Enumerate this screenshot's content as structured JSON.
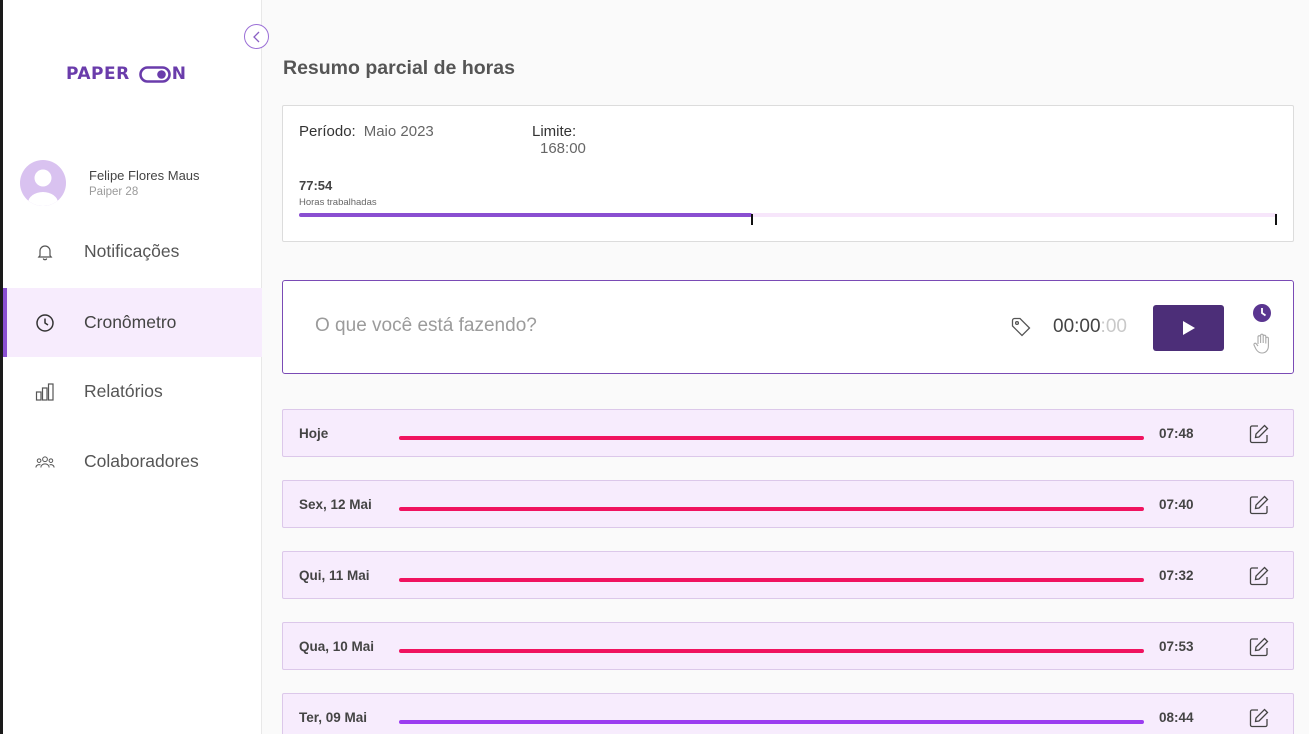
{
  "brand": {
    "name_left": "PAPER",
    "name_right": "N",
    "color": "#6a3cab"
  },
  "user": {
    "name": "Felipe Flores Maus",
    "subtitle": "Paiper 28"
  },
  "nav": {
    "items": [
      {
        "label": "Notificações",
        "icon": "bell-icon",
        "active": false
      },
      {
        "label": "Cronômetro",
        "icon": "clock-icon",
        "active": true
      },
      {
        "label": "Relatórios",
        "icon": "bar-chart-icon",
        "active": false
      },
      {
        "label": "Colaboradores",
        "icon": "users-icon",
        "active": false
      }
    ]
  },
  "summary": {
    "title": "Resumo parcial de horas",
    "period_label": "Período:",
    "period_value": "Maio 2023",
    "limit_label": "Limite:",
    "limit_value": "168:00",
    "hours_worked": "77:54",
    "hours_worked_label": "Horas trabalhadas",
    "progress_fraction": 0.4637,
    "progress_color": "#8a4fd1"
  },
  "timer": {
    "placeholder": "O que você está fazendo?",
    "time_main": "00:00",
    "time_seconds": ":00",
    "play_icon": "play-icon",
    "mode_icons": [
      "clock-mode-icon",
      "hand-mode-icon"
    ]
  },
  "days": [
    {
      "label": "Hoje",
      "total": "07:48",
      "bar_color": "#f0135f"
    },
    {
      "label": "Sex, 12 Mai",
      "total": "07:40",
      "bar_color": "#f0135f"
    },
    {
      "label": "Qui, 11 Mai",
      "total": "07:32",
      "bar_color": "#f0135f"
    },
    {
      "label": "Qua, 10 Mai",
      "total": "07:53",
      "bar_color": "#f0135f"
    },
    {
      "label": "Ter, 09 Mai",
      "total": "08:44",
      "bar_color": "#9b3cf0"
    }
  ]
}
